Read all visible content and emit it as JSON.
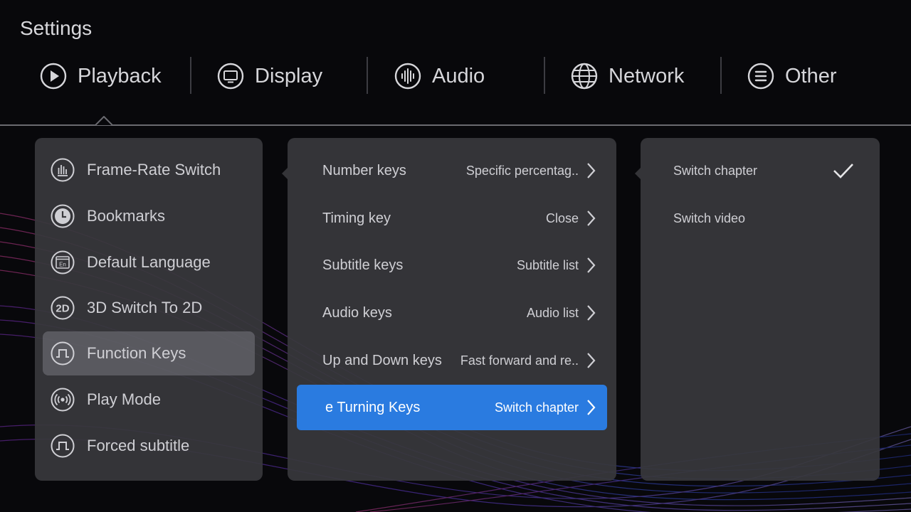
{
  "header": {
    "title": "Settings"
  },
  "tabs": [
    {
      "label": "Playback",
      "icon": "play-circle-icon"
    },
    {
      "label": "Display",
      "icon": "monitor-icon"
    },
    {
      "label": "Audio",
      "icon": "audio-wave-icon"
    },
    {
      "label": "Network",
      "icon": "globe-icon"
    },
    {
      "label": "Other",
      "icon": "menu-icon"
    }
  ],
  "menu": {
    "items": [
      {
        "label": "Frame-Rate Switch",
        "icon": "bar-chart-icon"
      },
      {
        "label": "Bookmarks",
        "icon": "clock-icon"
      },
      {
        "label": "Default Language",
        "icon": "language-icon"
      },
      {
        "label": "3D Switch To 2D",
        "icon": "2d-icon"
      },
      {
        "label": "Function Keys",
        "icon": "pulse-icon"
      },
      {
        "label": "Play Mode",
        "icon": "radio-wave-icon"
      },
      {
        "label": "Forced subtitle",
        "icon": "pulse-icon"
      }
    ],
    "selected": "Function Keys",
    "icon_2d_text": "2D",
    "icon_lang_text": "En"
  },
  "function_keys": {
    "items": [
      {
        "label": "Number keys",
        "value": "Specific percentag.."
      },
      {
        "label": "Timing key",
        "value": "Close"
      },
      {
        "label": "Subtitle keys",
        "value": "Subtitle list"
      },
      {
        "label": "Audio keys",
        "value": "Audio list"
      },
      {
        "label": "Up and Down keys",
        "value": "Fast forward and re.."
      },
      {
        "label": "e Turning Keys",
        "value": "Switch chapter"
      }
    ],
    "selected": "e Turning Keys"
  },
  "options": {
    "items": [
      {
        "label": "Switch chapter",
        "checked": true
      },
      {
        "label": "Switch video",
        "checked": false
      }
    ]
  },
  "colors": {
    "accent": "#2a7be0",
    "panel": "#38383c",
    "background": "#08080b"
  }
}
